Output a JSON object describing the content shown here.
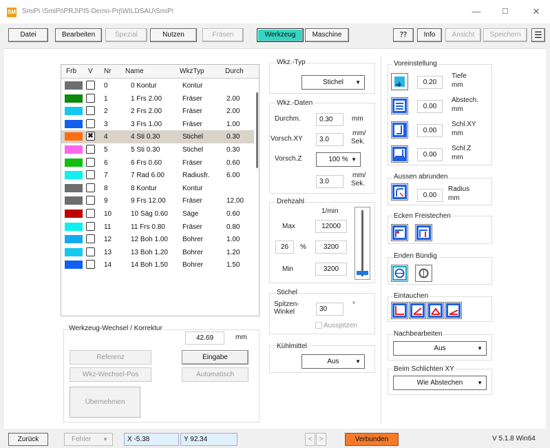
{
  "window": {
    "app_icon_text": "SM",
    "title": "SmiPi \\SmiPi\\PRJ\\PI5-Demo-Prj\\WILDSAU\\SmiPi",
    "minimize": "—",
    "maximize": "☐",
    "close": "✕"
  },
  "menu": {
    "datei": "Datei",
    "bearbeiten": "Bearbeiten",
    "spezial": "Spezial",
    "nutzen": "Nutzen",
    "fraesen": "Fräsen",
    "werkzeug": "Werkzeug",
    "maschine": "Maschine",
    "help": "⁇",
    "info": "Info",
    "ansicht": "Ansicht",
    "speichern": "Speichern",
    "hamburger": "☰"
  },
  "table": {
    "headers": [
      "Frb",
      "V",
      "Nr",
      "Name",
      "WkzTyp",
      "Durch"
    ],
    "rows": [
      {
        "color": "#6e6e6e",
        "checked": "",
        "nr": "0",
        "name": "0 Kontur",
        "typ": "Kontur",
        "durch": ""
      },
      {
        "color": "#0c8a0c",
        "checked": "",
        "nr": "1",
        "name": "1 Frs 2.00",
        "typ": "Fräser",
        "durch": "2.00"
      },
      {
        "color": "#14c8f0",
        "checked": "",
        "nr": "2",
        "name": "2 Frs 2.00",
        "typ": "Fräser",
        "durch": "2.00"
      },
      {
        "color": "#1060f0",
        "checked": "",
        "nr": "3",
        "name": "3 Frs 1.00",
        "typ": "Fräser",
        "durch": "1.00"
      },
      {
        "color": "#ff6e10",
        "checked": "✖",
        "nr": "4",
        "name": "4 Sti 0.30",
        "typ": "Stichel",
        "durch": "0.30"
      },
      {
        "color": "#ff66f0",
        "checked": "",
        "nr": "5",
        "name": "5 Sti 0.30",
        "typ": "Stichel",
        "durch": "0.30"
      },
      {
        "color": "#10c010",
        "checked": "",
        "nr": "6",
        "name": "6 Frs 0.60",
        "typ": "Fräser",
        "durch": "0.60"
      },
      {
        "color": "#10f0f0",
        "checked": "",
        "nr": "7",
        "name": "7 Rad 6.00",
        "typ": "Radiusfr.",
        "durch": "6.00"
      },
      {
        "color": "#6e6e6e",
        "checked": "",
        "nr": "8",
        "name": "8 Kontur",
        "typ": "Kontur",
        "durch": ""
      },
      {
        "color": "#6e6e6e",
        "checked": "",
        "nr": "9",
        "name": "9 Frs 12.00",
        "typ": "Fräser",
        "durch": "12.00"
      },
      {
        "color": "#c00000",
        "checked": "",
        "nr": "10",
        "name": "10 Säg 0.60",
        "typ": "Säge",
        "durch": "0.60"
      },
      {
        "color": "#10f0f0",
        "checked": "",
        "nr": "11",
        "name": "11 Frs 0.80",
        "typ": "Fräser",
        "durch": "0.80"
      },
      {
        "color": "#14a8f0",
        "checked": "",
        "nr": "12",
        "name": "12 Boh 1.00",
        "typ": "Bohrer",
        "durch": "1.00"
      },
      {
        "color": "#14c8f0",
        "checked": "",
        "nr": "13",
        "name": "13 Boh 1.20",
        "typ": "Bohrer",
        "durch": "1.20"
      },
      {
        "color": "#1060f0",
        "checked": "",
        "nr": "14",
        "name": "14 Boh 1.50",
        "typ": "Bohrer",
        "durch": "1.50"
      }
    ],
    "selected_index": 4
  },
  "wechsel": {
    "title": "Werkzeug-Wechsel / Korrektur",
    "value": "42.69",
    "unit": "mm",
    "referenz": "Referenz",
    "eingabe": "Eingabe",
    "wkz_wechsel_pos": "Wkz-Wechsel-Pos",
    "automatisch": "Automatisch",
    "uebernehmen": "Übernehmen"
  },
  "wkz_typ": {
    "title": "Wkz.-Typ",
    "value": "Stichel"
  },
  "wkz_daten": {
    "title": "Wkz.-Daten",
    "durchm_label": "Durchm.",
    "durchm_value": "0.30",
    "durchm_unit": "mm",
    "vorsch_xy_label": "Vorsch.XY",
    "vorsch_xy_value": "3.0",
    "vorsch_xy_unit1": "mm/",
    "vorsch_xy_unit2": "Sek.",
    "vorsch_z_label": "Vorsch.Z",
    "vorsch_z_value": "100 %",
    "vorsch_z2_value": "3.0",
    "vorsch_z2_unit1": "mm/",
    "vorsch_z2_unit2": "Sek."
  },
  "drehzahl": {
    "title": "Drehzahl",
    "unit": "1/min",
    "max_label": "Max",
    "max_value": "12000",
    "pct_value": "26",
    "pct_sign": "%",
    "current_value": "3200",
    "min_label": "Min",
    "min_value": "3200",
    "level_fraction": 0.05
  },
  "stichel": {
    "title": "Stichel",
    "spitzen_label1": "Spitzen-",
    "spitzen_label2": "Winkel",
    "spitzen_value": "30",
    "deg": "°",
    "ausspitzen": "Ausspitzen"
  },
  "kuehlmittel": {
    "title": "Kühlmittel",
    "value": "Aus"
  },
  "voreinstellung": {
    "title": "Voreinstellung",
    "tiefe_value": "0.20",
    "tiefe_label1": "Tiefe",
    "tiefe_label2": "mm",
    "abstech_value": "0.00",
    "abstech_label1": "Abstech.",
    "abstech_label2": "mm",
    "schl_xy_value": "0.00",
    "schl_xy_label1": "Schl.XY",
    "schl_xy_label2": "mm",
    "schl_z_value": "0.00",
    "schl_z_label1": "Schl.Z",
    "schl_z_label2": "mm"
  },
  "aussen": {
    "title": "Aussen abrunden",
    "value": "0.00",
    "label1": "Radius",
    "label2": "mm"
  },
  "ecken": {
    "title": "Ecken Freistechen"
  },
  "enden": {
    "title": "Enden Bündig"
  },
  "eintauchen": {
    "title": "Eintauchen"
  },
  "nachbearbeiten": {
    "title": "Nachbearbeiten",
    "value": "Aus"
  },
  "schlichten": {
    "title": "Beim Schlichten XY",
    "value": "Wie Abstechen"
  },
  "status": {
    "zurueck": "Zurück",
    "fehler": "Fehler",
    "x": "X -5.38",
    "y": "Y 92.34",
    "prev": "<",
    "next": ">",
    "verbunden": "Verbunden",
    "version": "V 5.1.8 Win64"
  },
  "colors": {
    "accent": "#33d6c2",
    "verbunden": "#f47a2a",
    "selected_row": "#d9d3c9"
  }
}
